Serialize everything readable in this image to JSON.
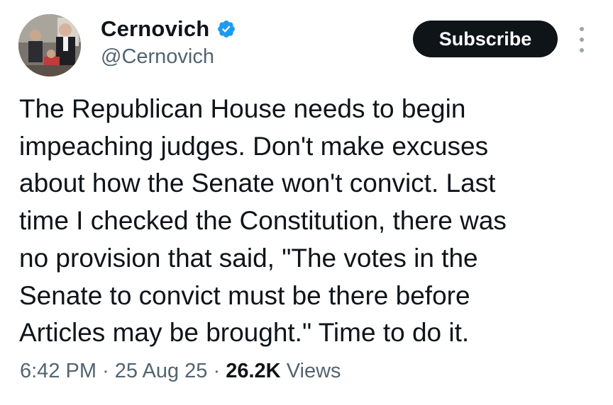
{
  "author": {
    "display_name": "Cernovich",
    "handle": "@Cernovich",
    "verified": true
  },
  "subscribe_label": "Subscribe",
  "tweet": {
    "lines": [
      "The Republican House needs to begin",
      "impeaching judges. Don't make excuses",
      "about how the Senate won't convict. Last",
      "time I checked the Constitution, there was",
      "no provision that said, \"The votes in the",
      "Senate to convict must be there before",
      "Articles may be brought.\" Time to do it."
    ]
  },
  "meta": {
    "time": "6:42 PM",
    "separator": "·",
    "date": "25 Aug 25",
    "views_count": "26.2K",
    "views_label": "Views"
  },
  "colors": {
    "text_primary": "#0f1419",
    "text_secondary": "#536471",
    "verified_blue": "#1d9bf0",
    "button_bg": "#0f1419"
  },
  "icons": {
    "verified": "verified-badge-icon",
    "more": "more-options-icon"
  }
}
